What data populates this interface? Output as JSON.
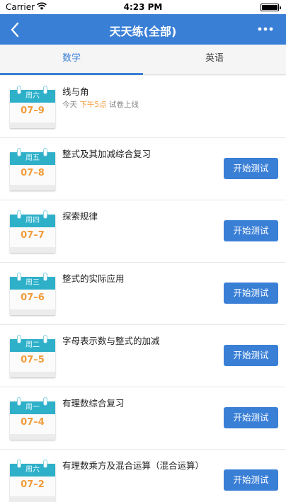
{
  "status_bar": {
    "carrier": "Carrier",
    "time": "4:23 PM"
  },
  "nav_bar": {
    "title": "天天练(全部)"
  },
  "tabs": [
    {
      "label": "数学",
      "active": true
    },
    {
      "label": "英语",
      "active": false
    }
  ],
  "colors": {
    "primary": "#3a7fd6",
    "calendar_header": "#2fb0c9",
    "date_orange": "#f29b38"
  },
  "items": [
    {
      "weekday": "周六",
      "date": "07–9",
      "title": "线与角",
      "sub_prefix": "今天",
      "sub_highlight": "下午5点",
      "sub_suffix": "试卷上线",
      "button": ""
    },
    {
      "weekday": "周五",
      "date": "07–8",
      "title": "整式及其加减综合复习",
      "button": "开始测试"
    },
    {
      "weekday": "周四",
      "date": "07–7",
      "title": "探索规律",
      "button": "开始测试"
    },
    {
      "weekday": "周三",
      "date": "07–6",
      "title": "整式的实际应用",
      "button": "开始测试"
    },
    {
      "weekday": "周二",
      "date": "07–5",
      "title": "字母表示数与整式的加减",
      "button": "开始测试"
    },
    {
      "weekday": "周一",
      "date": "07–4",
      "title": "有理数综合复习",
      "button": "开始测试"
    },
    {
      "weekday": "周六",
      "date": "07–2",
      "title": "有理数乘方及混合运算（混合运算）",
      "button": "开始测试"
    }
  ]
}
